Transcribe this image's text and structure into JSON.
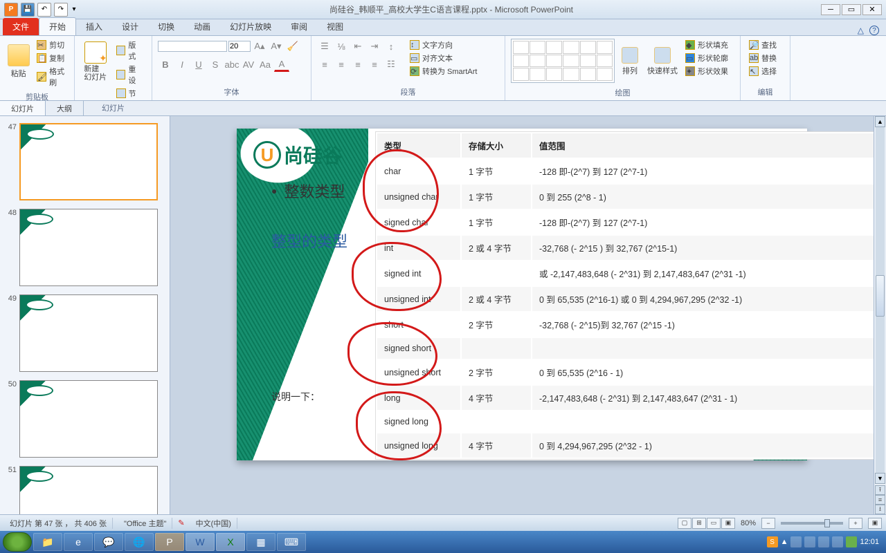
{
  "window": {
    "title": "尚硅谷_韩顺平_高校大学生C语言课程.pptx - Microsoft PowerPoint"
  },
  "tabs": {
    "file": "文件",
    "home": "开始",
    "insert": "插入",
    "design": "设计",
    "transitions": "切换",
    "animations": "动画",
    "slideshow": "幻灯片放映",
    "review": "审阅",
    "view": "视图"
  },
  "ribbon": {
    "clipboard": {
      "label": "剪贴板",
      "paste": "粘贴",
      "cut": "剪切",
      "copy": "复制",
      "format_painter": "格式刷"
    },
    "slides": {
      "label": "幻灯片",
      "new_slide": "新建\n幻灯片",
      "layout": "版式",
      "reset": "重设",
      "section": "节"
    },
    "font": {
      "label": "字体",
      "size": "20"
    },
    "paragraph": {
      "label": "段落",
      "text_direction": "文字方向",
      "align_text": "对齐文本",
      "smartart": "转换为 SmartArt"
    },
    "drawing": {
      "label": "绘图",
      "arrange": "排列",
      "quick_styles": "快速样式",
      "shape_fill": "形状填充",
      "shape_outline": "形状轮廓",
      "shape_effects": "形状效果"
    },
    "editing": {
      "label": "编辑",
      "find": "查找",
      "replace": "替换",
      "select": "选择"
    }
  },
  "panel": {
    "slides_tab": "幻灯片",
    "outline_tab": "大纲"
  },
  "thumbnails": [
    {
      "num": "47"
    },
    {
      "num": "48"
    },
    {
      "num": "49"
    },
    {
      "num": "50"
    },
    {
      "num": "51"
    }
  ],
  "slide": {
    "logo_text": "尚硅谷",
    "heading": "整数类型",
    "subheading": "整型的类型",
    "note": "说明一下：",
    "table": {
      "headers": [
        "类型",
        "存储大小",
        "值范围"
      ],
      "rows": [
        {
          "type": "char",
          "size": "1 字节",
          "range": "-128 即-(2^7) 到 127 (2^7-1)",
          "grouped": true
        },
        {
          "type": "unsigned char",
          "size": "1 字节",
          "range": "0 到 255 (2^8 - 1)",
          "grouped": true
        },
        {
          "type": "signed char",
          "size": "1 字节",
          "range": "-128 即-(2^7) 到 127 (2^7-1)",
          "grouped": true
        },
        {
          "type": "int",
          "size": "2 或 4 字节",
          "range": "-32,768 (- 2^15 ) 到 32,767 (2^15-1)",
          "grouped": true
        },
        {
          "type": "signed int",
          "size": "",
          "range": "或 -2,147,483,648 (- 2^31) 到 2,147,483,647 (2^31 -1)",
          "grouped": true
        },
        {
          "type": "unsigned int",
          "size": "2 或 4 字节",
          "range": "0 到 65,535 (2^16-1) 或 0 到 4,294,967,295 (2^32 -1)",
          "grouped": true
        },
        {
          "type": "short",
          "size": "2 字节",
          "range": "-32,768 (- 2^15)到 32,767 (2^15 -1)",
          "grouped": true
        },
        {
          "type": "signed short",
          "size": "",
          "range": "",
          "grouped": true
        },
        {
          "type": "unsigned short",
          "size": "2 字节",
          "range": "0 到 65,535 (2^16 - 1)",
          "grouped": true
        },
        {
          "type": "long",
          "size": "4 字节",
          "range": "-2,147,483,648 (- 2^31) 到 2,147,483,647 (2^31 - 1)",
          "grouped": true
        },
        {
          "type": "signed long",
          "size": "",
          "range": "",
          "grouped": true
        },
        {
          "type": "unsigned long",
          "size": "4 字节",
          "range": "0 到 4,294,967,295 (2^32 - 1)",
          "grouped": true
        }
      ]
    }
  },
  "statusbar": {
    "slide_info": "幻灯片 第 47 张 ， 共 406 张",
    "theme": "\"Office 主题\"",
    "language": "中文(中国)",
    "zoom": "80%"
  },
  "taskbar": {
    "clock": "12:01"
  }
}
